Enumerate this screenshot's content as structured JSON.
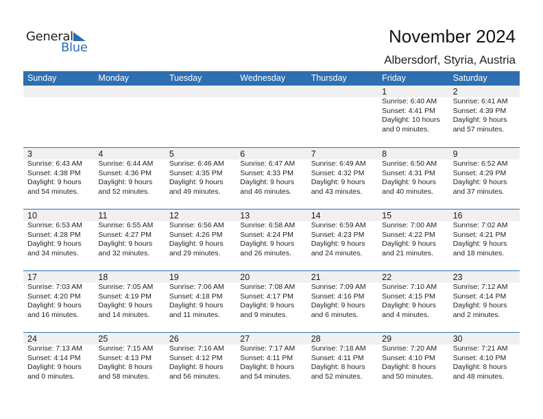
{
  "brand": {
    "part1": "General",
    "part2": "Blue"
  },
  "header": {
    "title": "November 2024",
    "location": "Albersdorf, Styria, Austria"
  },
  "colors": {
    "accent": "#2e6fb1",
    "day_band": "#f0f0f0"
  },
  "weekdays": [
    "Sunday",
    "Monday",
    "Tuesday",
    "Wednesday",
    "Thursday",
    "Friday",
    "Saturday"
  ],
  "weeks": [
    [
      {
        "day": "",
        "sunrise": "",
        "sunset": "",
        "daylight1": "",
        "daylight2": ""
      },
      {
        "day": "",
        "sunrise": "",
        "sunset": "",
        "daylight1": "",
        "daylight2": ""
      },
      {
        "day": "",
        "sunrise": "",
        "sunset": "",
        "daylight1": "",
        "daylight2": ""
      },
      {
        "day": "",
        "sunrise": "",
        "sunset": "",
        "daylight1": "",
        "daylight2": ""
      },
      {
        "day": "",
        "sunrise": "",
        "sunset": "",
        "daylight1": "",
        "daylight2": ""
      },
      {
        "day": "1",
        "sunrise": "Sunrise: 6:40 AM",
        "sunset": "Sunset: 4:41 PM",
        "daylight1": "Daylight: 10 hours",
        "daylight2": "and 0 minutes."
      },
      {
        "day": "2",
        "sunrise": "Sunrise: 6:41 AM",
        "sunset": "Sunset: 4:39 PM",
        "daylight1": "Daylight: 9 hours",
        "daylight2": "and 57 minutes."
      }
    ],
    [
      {
        "day": "3",
        "sunrise": "Sunrise: 6:43 AM",
        "sunset": "Sunset: 4:38 PM",
        "daylight1": "Daylight: 9 hours",
        "daylight2": "and 54 minutes."
      },
      {
        "day": "4",
        "sunrise": "Sunrise: 6:44 AM",
        "sunset": "Sunset: 4:36 PM",
        "daylight1": "Daylight: 9 hours",
        "daylight2": "and 52 minutes."
      },
      {
        "day": "5",
        "sunrise": "Sunrise: 6:46 AM",
        "sunset": "Sunset: 4:35 PM",
        "daylight1": "Daylight: 9 hours",
        "daylight2": "and 49 minutes."
      },
      {
        "day": "6",
        "sunrise": "Sunrise: 6:47 AM",
        "sunset": "Sunset: 4:33 PM",
        "daylight1": "Daylight: 9 hours",
        "daylight2": "and 46 minutes."
      },
      {
        "day": "7",
        "sunrise": "Sunrise: 6:49 AM",
        "sunset": "Sunset: 4:32 PM",
        "daylight1": "Daylight: 9 hours",
        "daylight2": "and 43 minutes."
      },
      {
        "day": "8",
        "sunrise": "Sunrise: 6:50 AM",
        "sunset": "Sunset: 4:31 PM",
        "daylight1": "Daylight: 9 hours",
        "daylight2": "and 40 minutes."
      },
      {
        "day": "9",
        "sunrise": "Sunrise: 6:52 AM",
        "sunset": "Sunset: 4:29 PM",
        "daylight1": "Daylight: 9 hours",
        "daylight2": "and 37 minutes."
      }
    ],
    [
      {
        "day": "10",
        "sunrise": "Sunrise: 6:53 AM",
        "sunset": "Sunset: 4:28 PM",
        "daylight1": "Daylight: 9 hours",
        "daylight2": "and 34 minutes."
      },
      {
        "day": "11",
        "sunrise": "Sunrise: 6:55 AM",
        "sunset": "Sunset: 4:27 PM",
        "daylight1": "Daylight: 9 hours",
        "daylight2": "and 32 minutes."
      },
      {
        "day": "12",
        "sunrise": "Sunrise: 6:56 AM",
        "sunset": "Sunset: 4:26 PM",
        "daylight1": "Daylight: 9 hours",
        "daylight2": "and 29 minutes."
      },
      {
        "day": "13",
        "sunrise": "Sunrise: 6:58 AM",
        "sunset": "Sunset: 4:24 PM",
        "daylight1": "Daylight: 9 hours",
        "daylight2": "and 26 minutes."
      },
      {
        "day": "14",
        "sunrise": "Sunrise: 6:59 AM",
        "sunset": "Sunset: 4:23 PM",
        "daylight1": "Daylight: 9 hours",
        "daylight2": "and 24 minutes."
      },
      {
        "day": "15",
        "sunrise": "Sunrise: 7:00 AM",
        "sunset": "Sunset: 4:22 PM",
        "daylight1": "Daylight: 9 hours",
        "daylight2": "and 21 minutes."
      },
      {
        "day": "16",
        "sunrise": "Sunrise: 7:02 AM",
        "sunset": "Sunset: 4:21 PM",
        "daylight1": "Daylight: 9 hours",
        "daylight2": "and 18 minutes."
      }
    ],
    [
      {
        "day": "17",
        "sunrise": "Sunrise: 7:03 AM",
        "sunset": "Sunset: 4:20 PM",
        "daylight1": "Daylight: 9 hours",
        "daylight2": "and 16 minutes."
      },
      {
        "day": "18",
        "sunrise": "Sunrise: 7:05 AM",
        "sunset": "Sunset: 4:19 PM",
        "daylight1": "Daylight: 9 hours",
        "daylight2": "and 14 minutes."
      },
      {
        "day": "19",
        "sunrise": "Sunrise: 7:06 AM",
        "sunset": "Sunset: 4:18 PM",
        "daylight1": "Daylight: 9 hours",
        "daylight2": "and 11 minutes."
      },
      {
        "day": "20",
        "sunrise": "Sunrise: 7:08 AM",
        "sunset": "Sunset: 4:17 PM",
        "daylight1": "Daylight: 9 hours",
        "daylight2": "and 9 minutes."
      },
      {
        "day": "21",
        "sunrise": "Sunrise: 7:09 AM",
        "sunset": "Sunset: 4:16 PM",
        "daylight1": "Daylight: 9 hours",
        "daylight2": "and 6 minutes."
      },
      {
        "day": "22",
        "sunrise": "Sunrise: 7:10 AM",
        "sunset": "Sunset: 4:15 PM",
        "daylight1": "Daylight: 9 hours",
        "daylight2": "and 4 minutes."
      },
      {
        "day": "23",
        "sunrise": "Sunrise: 7:12 AM",
        "sunset": "Sunset: 4:14 PM",
        "daylight1": "Daylight: 9 hours",
        "daylight2": "and 2 minutes."
      }
    ],
    [
      {
        "day": "24",
        "sunrise": "Sunrise: 7:13 AM",
        "sunset": "Sunset: 4:14 PM",
        "daylight1": "Daylight: 9 hours",
        "daylight2": "and 0 minutes."
      },
      {
        "day": "25",
        "sunrise": "Sunrise: 7:15 AM",
        "sunset": "Sunset: 4:13 PM",
        "daylight1": "Daylight: 8 hours",
        "daylight2": "and 58 minutes."
      },
      {
        "day": "26",
        "sunrise": "Sunrise: 7:16 AM",
        "sunset": "Sunset: 4:12 PM",
        "daylight1": "Daylight: 8 hours",
        "daylight2": "and 56 minutes."
      },
      {
        "day": "27",
        "sunrise": "Sunrise: 7:17 AM",
        "sunset": "Sunset: 4:11 PM",
        "daylight1": "Daylight: 8 hours",
        "daylight2": "and 54 minutes."
      },
      {
        "day": "28",
        "sunrise": "Sunrise: 7:18 AM",
        "sunset": "Sunset: 4:11 PM",
        "daylight1": "Daylight: 8 hours",
        "daylight2": "and 52 minutes."
      },
      {
        "day": "29",
        "sunrise": "Sunrise: 7:20 AM",
        "sunset": "Sunset: 4:10 PM",
        "daylight1": "Daylight: 8 hours",
        "daylight2": "and 50 minutes."
      },
      {
        "day": "30",
        "sunrise": "Sunrise: 7:21 AM",
        "sunset": "Sunset: 4:10 PM",
        "daylight1": "Daylight: 8 hours",
        "daylight2": "and 48 minutes."
      }
    ]
  ]
}
